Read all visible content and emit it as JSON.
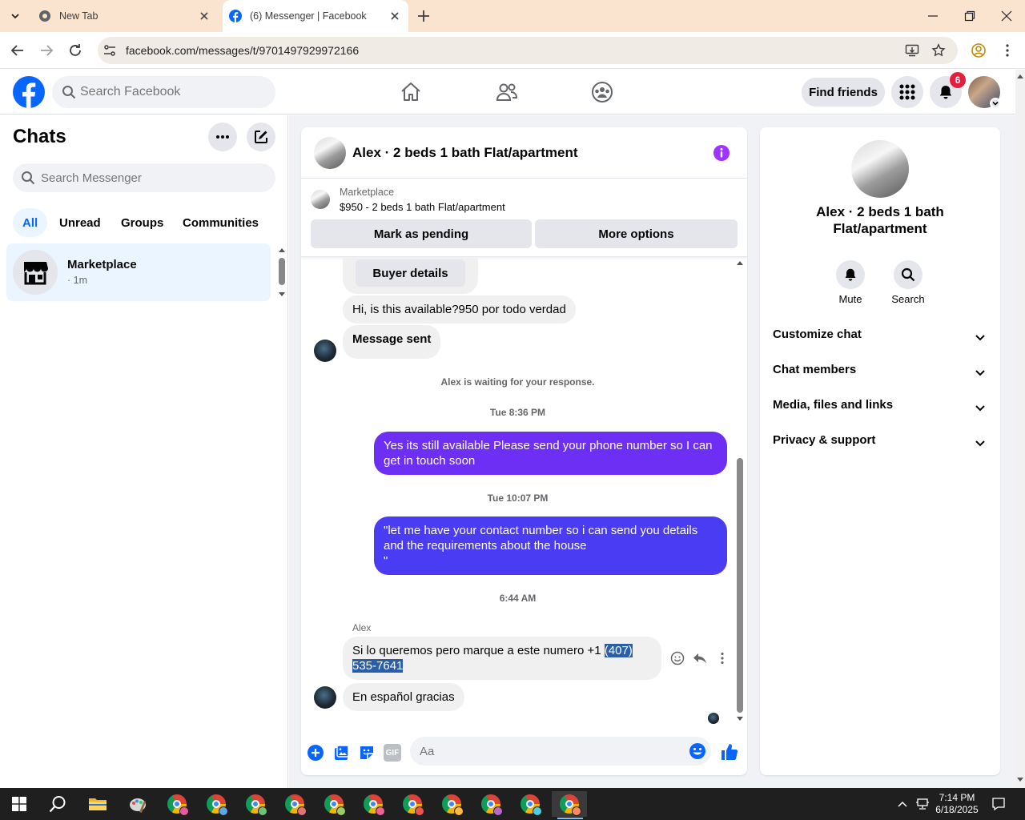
{
  "browser": {
    "tabs": [
      {
        "title": "New Tab",
        "active": false
      },
      {
        "title": "(6) Messenger | Facebook",
        "active": true
      }
    ],
    "url": "facebook.com/messages/t/9701497929972166"
  },
  "fb_header": {
    "search_placeholder": "Search Facebook",
    "find_friends": "Find friends",
    "notification_count": "6"
  },
  "sidebar": {
    "title": "Chats",
    "search_placeholder": "Search Messenger",
    "filters": [
      "All",
      "Unread",
      "Groups",
      "Communities"
    ],
    "active_filter": "All",
    "chats": [
      {
        "name": "Marketplace",
        "time": "· 1m"
      }
    ]
  },
  "conversation": {
    "title": "Alex · 2 beds 1 bath Flat/apartment",
    "marketplace_label": "Marketplace",
    "listing": "$950 - 2 beds 1 bath Flat/apartment",
    "buttons": {
      "mark_pending": "Mark as pending",
      "more_options": "More options"
    },
    "messages": {
      "buyer_details": "Buyer details",
      "m1": "Hi, is this available?950 por todo verdad",
      "m2": "Message sent",
      "waiting": "Alex is waiting for your response.",
      "ts1": "Tue 8:36 PM",
      "m3": "Yes its still available Please send your phone number so I can get in touch soon",
      "ts2": "Tue 10:07 PM",
      "m4_line1": "\"let me have your contact number so i can send you details and the requirements about the house",
      "m4_line2": "\"",
      "ts3": "6:44 AM",
      "sender": "Alex",
      "m5_pre": "Si lo queremos pero marque a este numero +1 ",
      "m5_highlight": "(407) 535-7641",
      "m6": "En español gracias"
    },
    "composer_placeholder": "Aa",
    "gif_label": "GIF"
  },
  "info_panel": {
    "name": "Alex · 2 beds 1 bath Flat/apartment",
    "actions": [
      "Mute",
      "Search"
    ],
    "sections": [
      "Customize chat",
      "Chat members",
      "Media, files and links",
      "Privacy & support"
    ]
  },
  "taskbar": {
    "time": "7:14 PM",
    "date": "6/18/2025"
  },
  "colors": {
    "facebook_blue": "#0866ff",
    "messenger_purple": "#a033ff",
    "out_bubble_1": "#6e2ff5",
    "out_bubble_2": "#4a3cf2",
    "badge_red": "#e41e3f"
  }
}
